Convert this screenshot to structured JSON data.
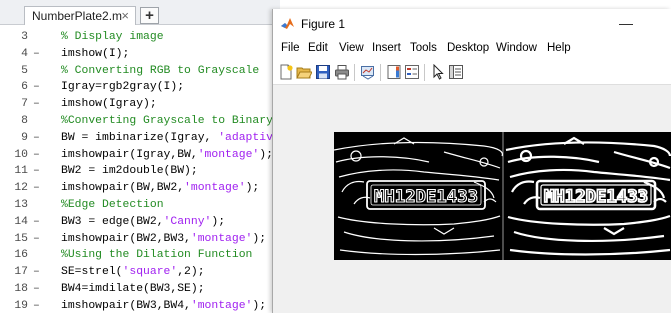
{
  "editor": {
    "tab_label": "NumberPlate2.m",
    "tab_close": "×",
    "add_tab": "+",
    "lines": [
      {
        "num": "3",
        "marker": "",
        "parts": [
          {
            "t": "% Display image",
            "k": "comment"
          }
        ]
      },
      {
        "num": "4",
        "marker": "–",
        "parts": [
          {
            "t": "imshow(I);",
            "k": "plain"
          }
        ]
      },
      {
        "num": "5",
        "marker": "",
        "parts": [
          {
            "t": "% Converting RGB to Grayscale",
            "k": "comment"
          }
        ]
      },
      {
        "num": "6",
        "marker": "–",
        "parts": [
          {
            "t": "Igray=rgb2gray(I);",
            "k": "plain"
          }
        ]
      },
      {
        "num": "7",
        "marker": "–",
        "parts": [
          {
            "t": "imshow(Igray);",
            "k": "plain"
          }
        ]
      },
      {
        "num": "8",
        "marker": "",
        "parts": [
          {
            "t": "%Converting Grayscale to Binary",
            "k": "comment"
          }
        ]
      },
      {
        "num": "9",
        "marker": "–",
        "parts": [
          {
            "t": "BW = imbinarize(Igray, ",
            "k": "plain"
          },
          {
            "t": "'adaptiv",
            "k": "str"
          }
        ]
      },
      {
        "num": "10",
        "marker": "–",
        "parts": [
          {
            "t": "imshowpair(Igray,BW,",
            "k": "plain"
          },
          {
            "t": "'montage'",
            "k": "str"
          },
          {
            "t": ");",
            "k": "plain"
          }
        ]
      },
      {
        "num": "11",
        "marker": "–",
        "parts": [
          {
            "t": "BW2 = im2double(BW);",
            "k": "plain"
          }
        ]
      },
      {
        "num": "12",
        "marker": "–",
        "parts": [
          {
            "t": "imshowpair(BW,BW2,",
            "k": "plain"
          },
          {
            "t": "'montage'",
            "k": "str"
          },
          {
            "t": ");",
            "k": "plain"
          }
        ]
      },
      {
        "num": "13",
        "marker": "",
        "parts": [
          {
            "t": "%Edge Detection",
            "k": "comment"
          }
        ]
      },
      {
        "num": "14",
        "marker": "–",
        "parts": [
          {
            "t": "BW3 = edge(BW2,",
            "k": "plain"
          },
          {
            "t": "'Canny'",
            "k": "str"
          },
          {
            "t": ");",
            "k": "plain"
          }
        ]
      },
      {
        "num": "15",
        "marker": "–",
        "parts": [
          {
            "t": "imshowpair(BW2,BW3,",
            "k": "plain"
          },
          {
            "t": "'montage'",
            "k": "str"
          },
          {
            "t": ");",
            "k": "plain"
          }
        ]
      },
      {
        "num": "16",
        "marker": "",
        "parts": [
          {
            "t": "%Using the Dilation Function",
            "k": "comment"
          }
        ]
      },
      {
        "num": "17",
        "marker": "–",
        "parts": [
          {
            "t": "SE=strel(",
            "k": "plain"
          },
          {
            "t": "'square'",
            "k": "str"
          },
          {
            "t": ",2);",
            "k": "plain"
          }
        ]
      },
      {
        "num": "18",
        "marker": "–",
        "parts": [
          {
            "t": "BW4=imdilate(BW3,SE);",
            "k": "plain"
          }
        ]
      },
      {
        "num": "19",
        "marker": "–",
        "parts": [
          {
            "t": "imshowpair(BW3,BW4,",
            "k": "plain"
          },
          {
            "t": "'montage'",
            "k": "str"
          },
          {
            "t": ");",
            "k": "plain"
          }
        ]
      }
    ]
  },
  "figure": {
    "title": "Figure 1",
    "minimize_glyph": "—",
    "menu": [
      "File",
      "Edit",
      "View",
      "Insert",
      "Tools",
      "Desktop",
      "Window",
      "Help"
    ],
    "toolbar_icons": [
      "new-figure-icon",
      "open-file-icon",
      "save-icon",
      "print-icon",
      "link-plot-icon",
      "insert-colorbar-icon",
      "insert-legend-icon",
      "pointer-icon",
      "property-inspector-icon"
    ],
    "plate_text": "MH12DE1433"
  },
  "colors": {
    "comment": "#228B22",
    "string": "#a020f0",
    "line_number": "#4a4a4a"
  }
}
